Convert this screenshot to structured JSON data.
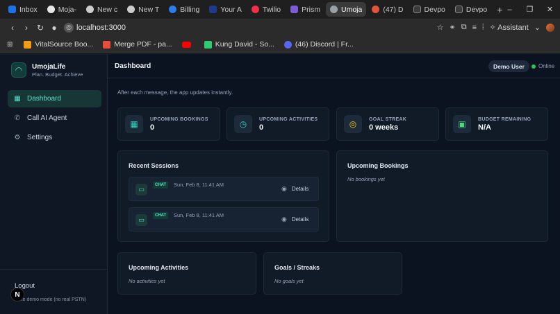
{
  "browser": {
    "tabs": [
      {
        "label": "Inbox",
        "color": "#1a73e8"
      },
      {
        "label": "Moja-",
        "color": "#e6e6e6"
      },
      {
        "label": "New c",
        "color": "#cccccc"
      },
      {
        "label": "New T",
        "color": "#cccccc"
      },
      {
        "label": "Billing",
        "color": "#2b7de9"
      },
      {
        "label": "Your A",
        "color": "#1e3a8a"
      },
      {
        "label": "Twilio",
        "color": "#f22f46"
      },
      {
        "label": "Prism",
        "color": "#7b5cd6"
      },
      {
        "label": "Umoja",
        "color": "#9aa0a6"
      },
      {
        "label": "(47) D",
        "color": "#e0553a"
      },
      {
        "label": "Devpo",
        "color": "#2b2b2b"
      },
      {
        "label": "Devpo",
        "color": "#2b2b2b"
      }
    ],
    "active_tab_index": 8,
    "new_tab": "+",
    "window_controls": [
      "–",
      "❐",
      "✕"
    ],
    "url": "localhost:3000",
    "assistant_label": "Assistant",
    "bookmarks": [
      {
        "label": "VitalSource Boo...",
        "color": "#f39c12"
      },
      {
        "label": "Merge PDF - pa...",
        "color": "#e74c3c"
      },
      {
        "label": "",
        "color": "#ff0000"
      },
      {
        "label": "Kung David - So...",
        "color": "#2ecc71"
      },
      {
        "label": "(46) Discord | Fr...",
        "color": "#5865f2"
      }
    ]
  },
  "sidebar": {
    "brand_name": "UmojaLife",
    "brand_tagline": "Plan. Budget. Achieve",
    "items": [
      {
        "label": "Dashboard",
        "icon": "grid-icon",
        "active": true
      },
      {
        "label": "Call AI Agent",
        "icon": "phone-icon",
        "active": false
      },
      {
        "label": "Settings",
        "icon": "gear-icon",
        "active": false
      }
    ],
    "logout_label": "Logout",
    "mode_note": "Fake demo mode (no real PSTN)",
    "n_badge": "N"
  },
  "header": {
    "title": "Dashboard",
    "user": "Demo User",
    "status": "Online",
    "status_color": "#22c55e"
  },
  "hint": "After each message, the app updates instantly.",
  "stats": [
    {
      "label": "UPCOMING BOOKINGS",
      "value": "0",
      "icon": "calendar-icon",
      "color": "#2dd4bf"
    },
    {
      "label": "UPCOMING ACTIVITIES",
      "value": "0",
      "icon": "clock-icon",
      "color": "#2dd4bf"
    },
    {
      "label": "GOAL STREAK",
      "value": "0 weeks",
      "icon": "target-icon",
      "color": "#facc15"
    },
    {
      "label": "BUDGET REMAINING",
      "value": "N/A",
      "icon": "wallet-icon",
      "color": "#4ade80"
    }
  ],
  "recent_sessions": {
    "title": "Recent Sessions",
    "items": [
      {
        "badge": "CHAT",
        "time": "Sun, Feb 8, 11:41 AM",
        "action": "Details"
      },
      {
        "badge": "CHAT",
        "time": "Sun, Feb 8, 11:41 AM",
        "action": "Details"
      }
    ]
  },
  "upcoming_bookings": {
    "title": "Upcoming Bookings",
    "empty": "No bookings yet"
  },
  "upcoming_activities": {
    "title": "Upcoming Activities",
    "empty": "No activities yet"
  },
  "goals": {
    "title": "Goals / Streaks",
    "empty": "No goals yet"
  }
}
